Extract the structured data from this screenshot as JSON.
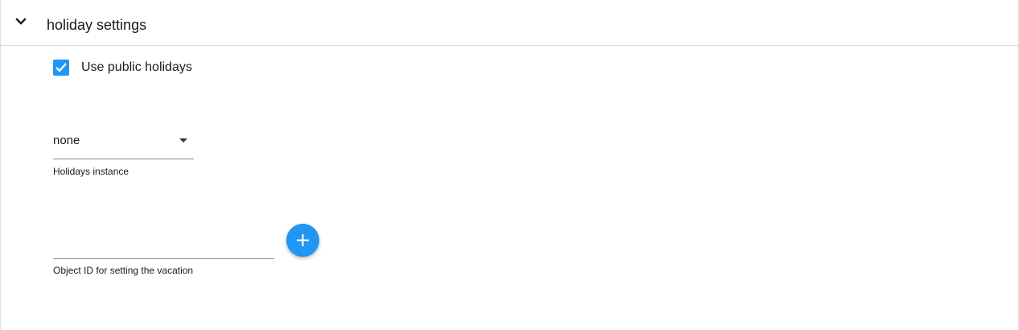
{
  "section": {
    "title": "holiday settings",
    "chevron_icon": "chevron-down-icon",
    "expanded": true
  },
  "public_holidays": {
    "label": "Use public holidays",
    "checked": true,
    "color": "#2196f3"
  },
  "holidays_instance": {
    "value": "none",
    "helper": "Holidays instance",
    "arrow_icon": "dropdown-arrow-icon"
  },
  "object_id": {
    "value": "",
    "helper": "Object ID for setting the vacation"
  },
  "add_button": {
    "icon": "plus-icon",
    "color": "#2196f3"
  }
}
